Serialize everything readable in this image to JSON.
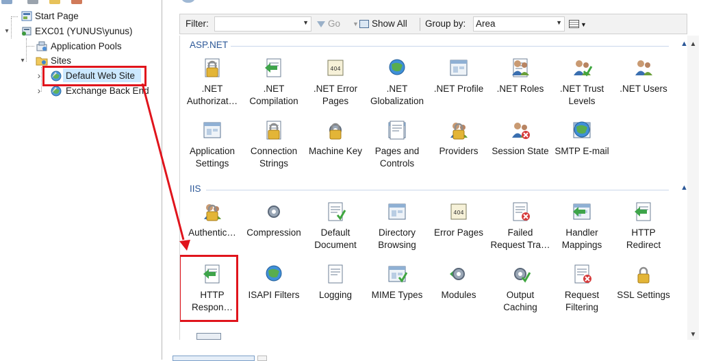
{
  "tree": {
    "items": [
      {
        "label": "Start Page",
        "icon": "start-page-icon",
        "expander": ""
      },
      {
        "label": "EXC01 (YUNUS\\yunus)",
        "icon": "server-icon",
        "expander": "▾"
      },
      {
        "label": "Application Pools",
        "icon": "app-pools-icon",
        "expander": ""
      },
      {
        "label": "Sites",
        "icon": "folder-icon",
        "expander": "▾"
      },
      {
        "label": "Default Web Site",
        "icon": "website-globe-icon",
        "expander": "›"
      },
      {
        "label": "Exchange Back End",
        "icon": "website-globe-icon",
        "expander": "›"
      }
    ]
  },
  "filter_bar": {
    "filter_label": "Filter:",
    "go_label": "Go",
    "show_all_label": "Show All",
    "group_by_label": "Group by:",
    "group_by_value": "Area"
  },
  "groups": [
    {
      "title": "ASP.NET",
      "features": [
        {
          "label": ".NET\nAuthorizat…",
          "icon": "net-authorization-icon"
        },
        {
          "label": ".NET\nCompilation",
          "icon": "net-compilation-icon"
        },
        {
          "label": ".NET Error\nPages",
          "icon": "net-error-pages-icon"
        },
        {
          "label": ".NET\nGlobalization",
          "icon": "net-globalization-icon"
        },
        {
          "label": ".NET Profile",
          "icon": "net-profile-icon"
        },
        {
          "label": ".NET Roles",
          "icon": "net-roles-icon"
        },
        {
          "label": ".NET Trust\nLevels",
          "icon": "net-trust-levels-icon"
        },
        {
          "label": ".NET Users",
          "icon": "net-users-icon"
        },
        {
          "label": "Application\nSettings",
          "icon": "application-settings-icon"
        },
        {
          "label": "Connection\nStrings",
          "icon": "connection-strings-icon"
        },
        {
          "label": "Machine Key",
          "icon": "machine-key-icon"
        },
        {
          "label": "Pages and\nControls",
          "icon": "pages-controls-icon"
        },
        {
          "label": "Providers",
          "icon": "providers-icon"
        },
        {
          "label": "Session State",
          "icon": "session-state-icon"
        },
        {
          "label": "SMTP E-mail",
          "icon": "smtp-email-icon"
        }
      ]
    },
    {
      "title": "IIS",
      "features": [
        {
          "label": "Authentic…",
          "icon": "authentication-icon"
        },
        {
          "label": "Compression",
          "icon": "compression-icon"
        },
        {
          "label": "Default\nDocument",
          "icon": "default-document-icon"
        },
        {
          "label": "Directory\nBrowsing",
          "icon": "directory-browsing-icon"
        },
        {
          "label": "Error Pages",
          "icon": "error-pages-icon"
        },
        {
          "label": "Failed\nRequest Tra…",
          "icon": "failed-request-tracing-icon"
        },
        {
          "label": "Handler\nMappings",
          "icon": "handler-mappings-icon"
        },
        {
          "label": "HTTP\nRedirect",
          "icon": "http-redirect-icon"
        },
        {
          "label": "HTTP\nRespon…",
          "icon": "http-response-headers-icon"
        },
        {
          "label": "ISAPI Filters",
          "icon": "isapi-filters-icon"
        },
        {
          "label": "Logging",
          "icon": "logging-icon"
        },
        {
          "label": "MIME Types",
          "icon": "mime-types-icon"
        },
        {
          "label": "Modules",
          "icon": "modules-icon"
        },
        {
          "label": "Output\nCaching",
          "icon": "output-caching-icon"
        },
        {
          "label": "Request\nFiltering",
          "icon": "request-filtering-icon"
        },
        {
          "label": "SSL Settings",
          "icon": "ssl-settings-icon"
        }
      ]
    }
  ],
  "colors": {
    "highlight": "#e0141c",
    "selection": "#cce8ff",
    "group_title": "#2b5797"
  }
}
